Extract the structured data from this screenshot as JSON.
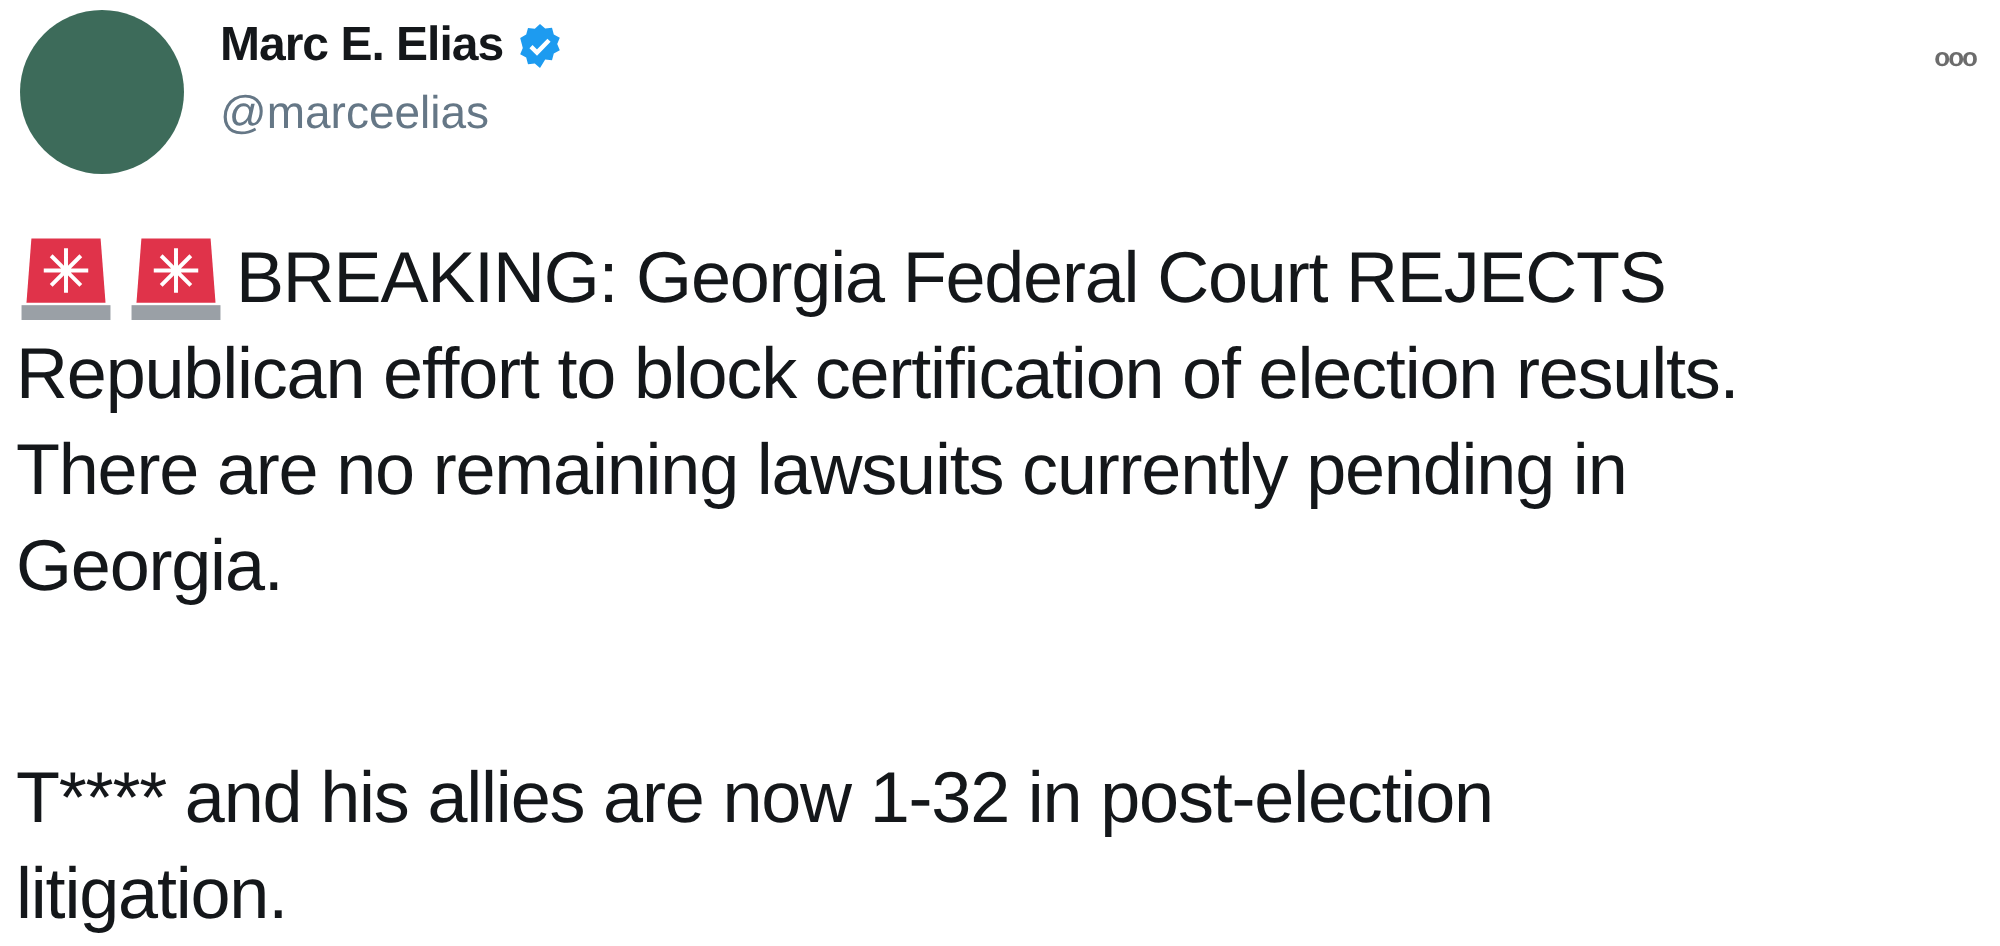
{
  "author": {
    "name": "Marc E. Elias",
    "verified": true,
    "handle": "@marceelias"
  },
  "more_menu": {
    "label": "ooo"
  },
  "paragraphs": [
    {
      "icons": [
        {
          "kind": "siren"
        },
        {
          "kind": "siren"
        }
      ],
      "lines": [
        "BREAKING: Georgia Federal Court REJECTS",
        "Republican effort to block certification of election results.",
        "There are no remaining lawsuits currently pending in",
        "Georgia."
      ]
    },
    {
      "lines": [
        "T**** and his allies are now 1-32 in post-election",
        "litigation."
      ]
    }
  ]
}
